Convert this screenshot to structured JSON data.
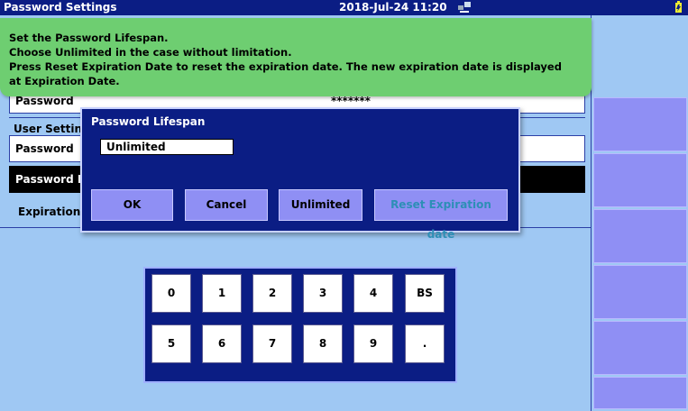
{
  "titlebar": {
    "title": "Password Settings",
    "datetime": "2018-Jul-24 11:20",
    "network_icon": "network-icon",
    "battery_icon": "battery-icon"
  },
  "hint": {
    "line1": "Set the Password Lifespan.",
    "line2": "Choose Unlimited in the case without limitation.",
    "line3": "Press Reset Expiration Date to reset the expiration date. The new expiration date is displayed",
    "line4": "at Expiration Date."
  },
  "settings": {
    "top_password_label": "Password",
    "top_password_value": "*******",
    "user_settings_label": "User Settin",
    "password_label": "Password",
    "password_lifespan_label": "Password I",
    "expiration_label": "Expiration"
  },
  "dialog": {
    "title": "Password Lifespan",
    "value": "Unlimited",
    "buttons": {
      "ok": "OK",
      "cancel": "Cancel",
      "unlimited": "Unlimited",
      "reset": "Reset Expiration date"
    }
  },
  "keypad": {
    "row1": [
      "0",
      "1",
      "2",
      "3",
      "4",
      "BS"
    ],
    "row2": [
      "5",
      "6",
      "7",
      "8",
      "9",
      "."
    ]
  },
  "colors": {
    "titlebar": "#0b1d84",
    "background": "#9fc8f3",
    "hint": "#6ece71",
    "button": "#8f8ff4"
  }
}
